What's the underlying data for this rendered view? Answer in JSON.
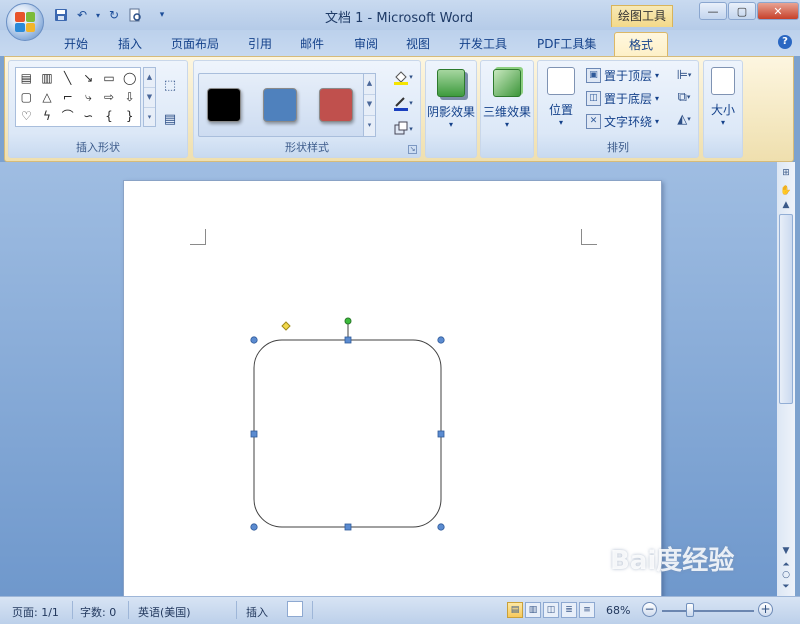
{
  "window": {
    "title": "文档 1 - Microsoft Word",
    "context_tab_label": "绘图工具",
    "minimize": "—",
    "maximize": "▢",
    "close": "✕"
  },
  "quick_access": [
    "save-icon",
    "undo-icon",
    "redo-icon",
    "print-preview-icon",
    "customize-icon"
  ],
  "tabs": [
    {
      "label": "开始"
    },
    {
      "label": "插入"
    },
    {
      "label": "页面布局"
    },
    {
      "label": "引用"
    },
    {
      "label": "邮件"
    },
    {
      "label": "审阅"
    },
    {
      "label": "视图"
    },
    {
      "label": "开发工具"
    },
    {
      "label": "PDF工具集"
    },
    {
      "label": "格式",
      "active": true
    }
  ],
  "ribbon": {
    "insert_shapes": {
      "label": "插入形状"
    },
    "shape_styles": {
      "label": "形状样式",
      "swatch_colors": [
        "#000000",
        "#4f81bd",
        "#c0504d"
      ]
    },
    "shadow": {
      "label": "阴影效果"
    },
    "three_d": {
      "label": "三维效果"
    },
    "arrange": {
      "label": "排列",
      "position": "位置",
      "bring_to_front": "置于顶层",
      "send_to_back": "置于底层",
      "text_wrap": "文字环绕"
    },
    "size": {
      "label": "大小"
    }
  },
  "status": {
    "page": "页面: 1/1",
    "words": "字数: 0",
    "language": "英语(美国)",
    "mode": "插入",
    "zoom": "68%"
  },
  "watermark": "Bai度经验",
  "colors": {
    "accent": "#15428b",
    "ribbon_bg": "#dce8f7",
    "active_tab": "#fdf0c6",
    "shape_stroke": "#404040",
    "handle": "#5b8bd0",
    "rotate_handle": "#3cbc3c",
    "adjust_handle": "#f2d84b"
  }
}
